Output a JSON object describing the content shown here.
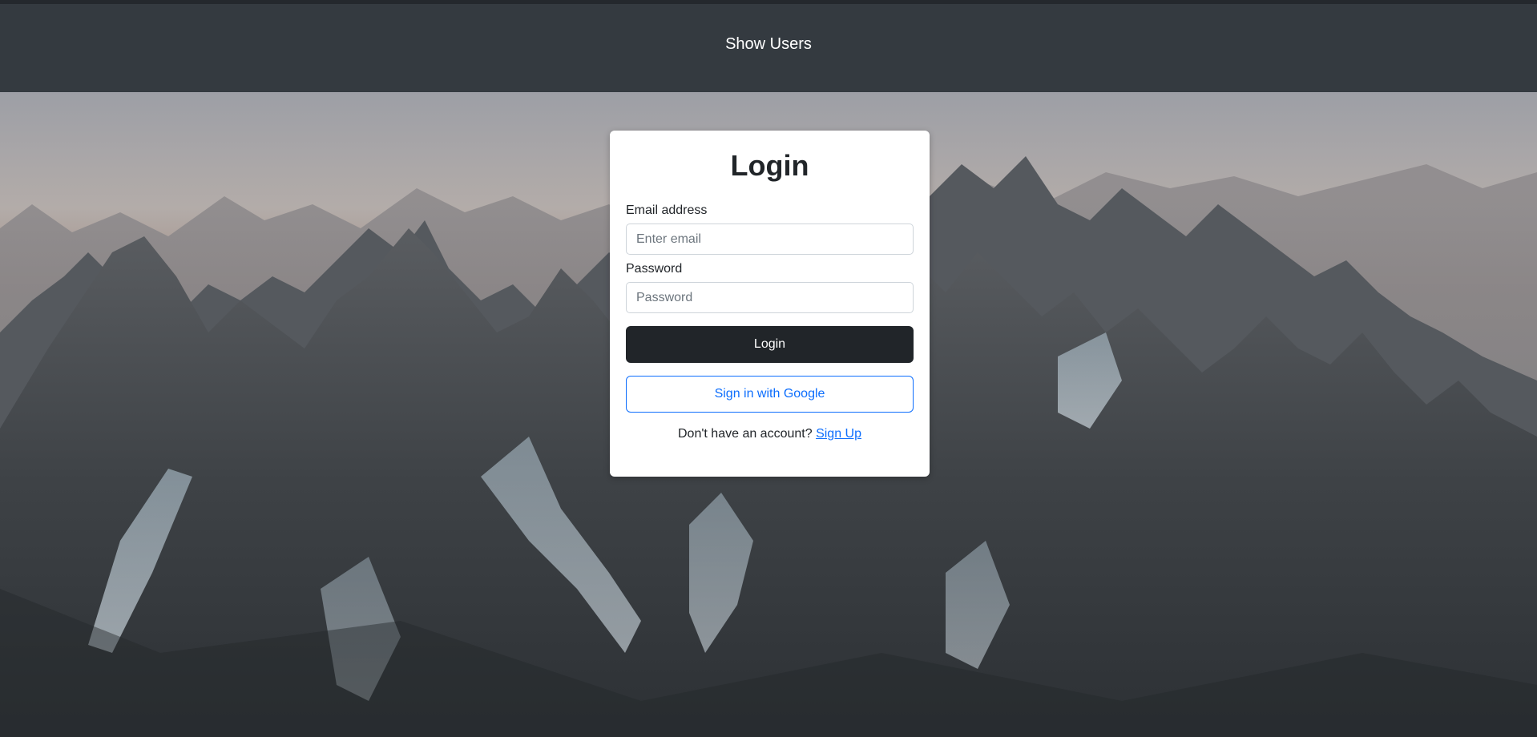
{
  "navbar": {
    "link_label": "Show Users"
  },
  "hero": {
    "description_icon": "mountain-landscape-image",
    "sky_color": "#a9a8ad",
    "rock_color": "#3e4347"
  },
  "login_card": {
    "title": "Login",
    "email_label": "Email address",
    "email_placeholder": "Enter email",
    "email_value": "",
    "password_label": "Password",
    "password_placeholder": "Password",
    "password_value": "",
    "login_button": "Login",
    "google_button": "Sign in with Google",
    "signup_prompt": "Don't have an account?",
    "signup_link": "Sign Up"
  },
  "colors": {
    "navbar_bg": "#343a40",
    "primary_button": "#212529",
    "google_accent": "#0d6efd"
  }
}
